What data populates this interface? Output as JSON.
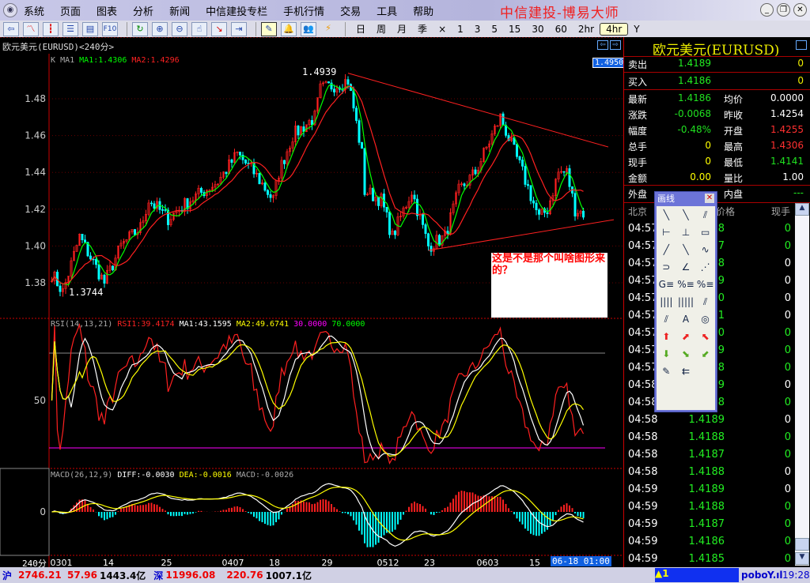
{
  "menu": {
    "items": [
      "系统",
      "页面",
      "图表",
      "分析",
      "新闻",
      "中信建投专栏",
      "手机行情",
      "交易",
      "工具",
      "帮助"
    ],
    "app_title": "中信建投-博易大师"
  },
  "toolbar": {
    "icons": [
      "back-icon",
      "line-chart-icon",
      "kline-icon",
      "list-icon",
      "report-icon",
      "f10-icon",
      "refresh-icon",
      "zoom-in-icon",
      "zoom-out-icon",
      "hand-icon",
      "window-icon",
      "export-icon",
      "draw-line-icon",
      "alarm-icon",
      "users-icon",
      "lightning-icon"
    ],
    "f10_label": "F10",
    "periods": [
      "日",
      "周",
      "月",
      "季",
      "×",
      "1",
      "3",
      "5",
      "15",
      "30",
      "60",
      "2hr",
      "4hr",
      "Y"
    ],
    "active_period": "4hr"
  },
  "chart": {
    "title": "欧元美元(EURUSD)<240分>",
    "legend": {
      "k": "K",
      "ma": "MA1",
      "ma1": "MA1:1.4306",
      "ma2": "MA2:1.4296"
    },
    "price_tag": "1.4950",
    "high_label": "1.4939",
    "low_label": "1.3744",
    "annotation": "这是不是那个叫啥图形来的？",
    "rsi_legend": {
      "name": "RSI(14,13,21)",
      "rsi1": "RSI1:39.4174",
      "ma1": "MA1:43.1595",
      "ma2": "MA2:49.6741",
      "l30": "30.0000",
      "l70": "70.0000"
    },
    "macd_legend": {
      "name": "MACD(26,12,9)",
      "diff": "DIFF:-0.0030",
      "dea": "DEA:-0.0016",
      "macd": "MACD:-0.0026"
    },
    "period_label": "240分",
    "cursor_time": "06-18 01:00"
  },
  "chart_data": {
    "type": "candlestick",
    "ylim": [
      1.367,
      1.497
    ],
    "yticks": [
      "1.48",
      "1.46",
      "1.44",
      "1.42",
      "1.40",
      "1.38"
    ],
    "rsi_ticks": [
      "50"
    ],
    "macd_ticks": [
      "0"
    ],
    "waypoints": [
      [
        0,
        1.385
      ],
      [
        4,
        1.375
      ],
      [
        10,
        1.405
      ],
      [
        19,
        1.38
      ],
      [
        25,
        1.4
      ],
      [
        32,
        1.41
      ],
      [
        35,
        1.425
      ],
      [
        42,
        1.415
      ],
      [
        50,
        1.425
      ],
      [
        60,
        1.435
      ],
      [
        67,
        1.45
      ],
      [
        73,
        1.44
      ],
      [
        80,
        1.425
      ],
      [
        82,
        1.44
      ],
      [
        87,
        1.46
      ],
      [
        95,
        1.47
      ],
      [
        97,
        1.485
      ],
      [
        107,
        1.49
      ],
      [
        109,
        1.475
      ],
      [
        112,
        1.45
      ],
      [
        113,
        1.43
      ],
      [
        119,
        1.425
      ],
      [
        123,
        1.405
      ],
      [
        130,
        1.43
      ],
      [
        136,
        1.4
      ],
      [
        142,
        1.405
      ],
      [
        147,
        1.43
      ],
      [
        153,
        1.44
      ],
      [
        162,
        1.47
      ],
      [
        166,
        1.455
      ],
      [
        170,
        1.44
      ],
      [
        176,
        1.415
      ],
      [
        179,
        1.42
      ],
      [
        183,
        1.44
      ],
      [
        186,
        1.44
      ],
      [
        189,
        1.42
      ],
      [
        192,
        1.418
      ]
    ],
    "xticks": [
      [
        0,
        "0301"
      ],
      [
        19,
        "14"
      ],
      [
        40,
        "25"
      ],
      [
        62,
        "0407"
      ],
      [
        79,
        "18"
      ],
      [
        98,
        "29"
      ],
      [
        118,
        "0512"
      ],
      [
        135,
        "23"
      ],
      [
        154,
        "0603"
      ],
      [
        173,
        "15"
      ]
    ],
    "trendlines": [
      {
        "from": [
          107,
          1.4939
        ],
        "to": [
          201,
          1.4538
        ]
      },
      {
        "from": [
          136,
          1.3976
        ],
        "to": [
          203,
          1.4143
        ]
      }
    ],
    "colors": {
      "up": "#ff2020",
      "down": "#00ffff",
      "ma1": "#00ff00",
      "ma2": "#ff2020",
      "rsi": "#ff2020",
      "rsima1": "#ffffff",
      "rsima2": "#ffff00",
      "l30": "#ff00ff",
      "l70": "#888888"
    }
  },
  "quote": {
    "title": "欧元美元(EURUSD)",
    "sell": {
      "label": "卖出",
      "price": "1.4189",
      "vol": "0"
    },
    "buy": {
      "label": "买入",
      "price": "1.4186",
      "vol": "0"
    },
    "rows": [
      {
        "l": "最新",
        "v": "1.4186",
        "vc": "#20e020",
        "l2": "均价",
        "v2": "0.0000",
        "v2c": "#fff"
      },
      {
        "l": "涨跌",
        "v": "-0.0068",
        "vc": "#20e020",
        "l2": "昨收",
        "v2": "1.4254",
        "v2c": "#fff"
      },
      {
        "l": "幅度",
        "v": "-0.48%",
        "vc": "#20e020",
        "l2": "开盘",
        "v2": "1.4255",
        "v2c": "#ff3030"
      },
      {
        "l": "总手",
        "v": "0",
        "vc": "#ffff00",
        "l2": "最高",
        "v2": "1.4306",
        "v2c": "#ff3030"
      },
      {
        "l": "现手",
        "v": "0",
        "vc": "#ffff00",
        "l2": "最低",
        "v2": "1.4141",
        "v2c": "#20e020"
      },
      {
        "l": "金额",
        "v": "0.00",
        "vc": "#ffff00",
        "l2": "量比",
        "v2": "1.00",
        "v2c": "#fff"
      }
    ],
    "outer": {
      "label": "外盘",
      "label2": "内盘",
      "v2": "---"
    },
    "tick_header": {
      "time": "北京",
      "price": "价格",
      "vol": "现手"
    },
    "ticks": [
      {
        "t": "04:57",
        "p": "8",
        "v": "0",
        "g": 1
      },
      {
        "t": "04:57",
        "p": "7",
        "v": "0",
        "g": 1
      },
      {
        "t": "04:57",
        "p": "8",
        "v": "0",
        "g": 0
      },
      {
        "t": "04:57",
        "p": "9",
        "v": "0",
        "g": 0
      },
      {
        "t": "04:57",
        "p": "0",
        "v": "0",
        "g": 0
      },
      {
        "t": "04:57",
        "p": "1",
        "v": "0",
        "g": 0
      },
      {
        "t": "04:57",
        "p": "0",
        "v": "0",
        "g": 1
      },
      {
        "t": "04:57",
        "p": "9",
        "v": "0",
        "g": 1
      },
      {
        "t": "04:57",
        "p": "8",
        "v": "0",
        "g": 1
      },
      {
        "t": "04:58",
        "p": "9",
        "v": "0",
        "g": 0
      },
      {
        "t": "04:58",
        "p": "8",
        "v": "0",
        "g": 1
      },
      {
        "t": "04:58",
        "p": "1.4189",
        "v": "0",
        "g": 0
      },
      {
        "t": "04:58",
        "p": "1.4188",
        "v": "0",
        "g": 1
      },
      {
        "t": "04:58",
        "p": "1.4187",
        "v": "0",
        "g": 1
      },
      {
        "t": "04:58",
        "p": "1.4188",
        "v": "0",
        "g": 0
      },
      {
        "t": "04:59",
        "p": "1.4189",
        "v": "0",
        "g": 0
      },
      {
        "t": "04:59",
        "p": "1.4188",
        "v": "0",
        "g": 1
      },
      {
        "t": "04:59",
        "p": "1.4187",
        "v": "0",
        "g": 1
      },
      {
        "t": "04:59",
        "p": "1.4186",
        "v": "0",
        "g": 1
      },
      {
        "t": "04:59",
        "p": "1.4185",
        "v": "0",
        "g": 1
      }
    ]
  },
  "draw_popup": {
    "title": "画线",
    "tools": [
      "line-segment-icon",
      "ray-icon",
      "parallel-line-icon",
      "horizontal-line-icon",
      "vertical-line-icon",
      "rectangle-icon",
      "up-line-icon",
      "down-line-icon",
      "wave-icon",
      "arc-icon",
      "angle-icon",
      "fan-icon",
      "gann-icon",
      "percent-icon",
      "fibonacci-icon",
      "period-line-icon",
      "fibonacci-time-icon",
      "speed-line-icon",
      "gann-fan-icon",
      "text-icon",
      "cycle-icon",
      "up-arrow-icon",
      "up-right-arrow-icon",
      "up-left-arrow-icon",
      "down-arrow-icon",
      "down-right-arrow-icon",
      "down-left-arrow-icon",
      "eraser-icon",
      "delete-all-icon"
    ],
    "glyphs": [
      "╲",
      "╲",
      "⫽",
      "⊢",
      "⊥",
      "▭",
      "╱",
      "╲",
      "∿",
      "⊃",
      "∠",
      "⋰",
      "G≡",
      "%≡",
      "%≡",
      "||||",
      "|||||",
      "⫽",
      "⫽",
      "A",
      "◎",
      "⬆",
      "⬈",
      "⬉",
      "⬇",
      "⬊",
      "⬋",
      "✎",
      "⇇"
    ]
  },
  "status": {
    "sh_label": "沪",
    "sh_index": "2746.21",
    "sh_change": "57.96",
    "sh_amount": "1443.4亿",
    "sz_label": "深",
    "sz_index": "11996.08",
    "sz_change": "220.76",
    "sz_amount": "1007.1亿",
    "alert": "1",
    "brand": "pobo",
    "time": "19:28"
  }
}
